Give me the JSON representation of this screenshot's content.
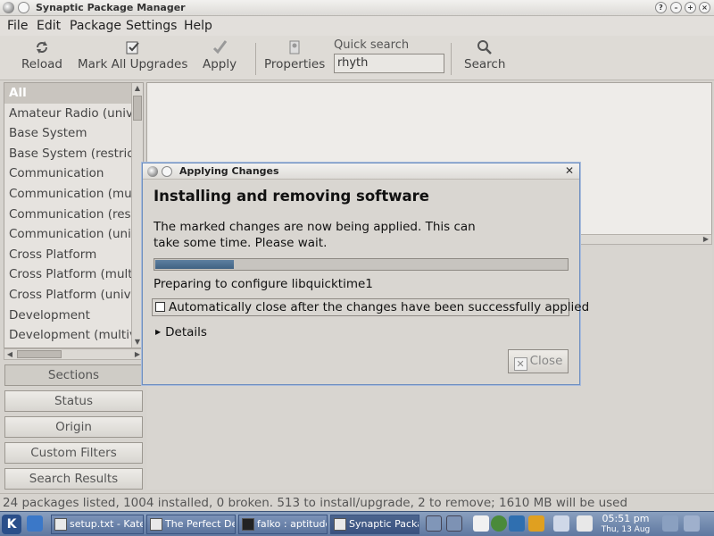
{
  "window": {
    "title": "Synaptic Package Manager"
  },
  "menu": [
    "File",
    "Edit",
    "Package",
    "Settings",
    "Help"
  ],
  "toolbar": {
    "reload": "Reload",
    "mark_all": "Mark All Upgrades",
    "apply": "Apply",
    "properties": "Properties",
    "quick_search_label": "Quick search",
    "quick_search_value": "rhyth",
    "search": "Search"
  },
  "sections": [
    "All",
    "Amateur Radio (univ",
    "Base System",
    "Base System (restric",
    "Communication",
    "Communication (mu",
    "Communication (res",
    "Communication (uni",
    "Cross Platform",
    "Cross Platform (mult",
    "Cross Platform (univ",
    "Development",
    "Development (multiv"
  ],
  "filter_buttons": [
    "Sections",
    "Status",
    "Origin",
    "Custom Filters",
    "Search Results"
  ],
  "status_bar": "24 packages listed, 1004 installed, 0 broken. 513 to install/upgrade, 2 to remove; 1610 MB will be used",
  "dialog": {
    "title": "Applying Changes",
    "heading": "Installing and removing software",
    "message": "The marked changes are now being applied. This can take some time. Please wait.",
    "progress_fraction": 0.19,
    "status": "Preparing to configure libquicktime1",
    "auto_close_label": "Automatically close after the changes have been successfully applied",
    "auto_close_checked": false,
    "details_label": "Details",
    "close_label": "Close"
  },
  "taskbar": {
    "tasks": [
      "setup.txt - Kate",
      "The Perfect Des",
      "falko : aptitude",
      "Synaptic Packa"
    ],
    "clock_time": "05:51 pm",
    "clock_date": "Thu, 13 Aug"
  },
  "colors": {
    "accent": "#4a6b8f",
    "selection": "#c9c5bf",
    "dialog_border": "#6e8fc0"
  }
}
